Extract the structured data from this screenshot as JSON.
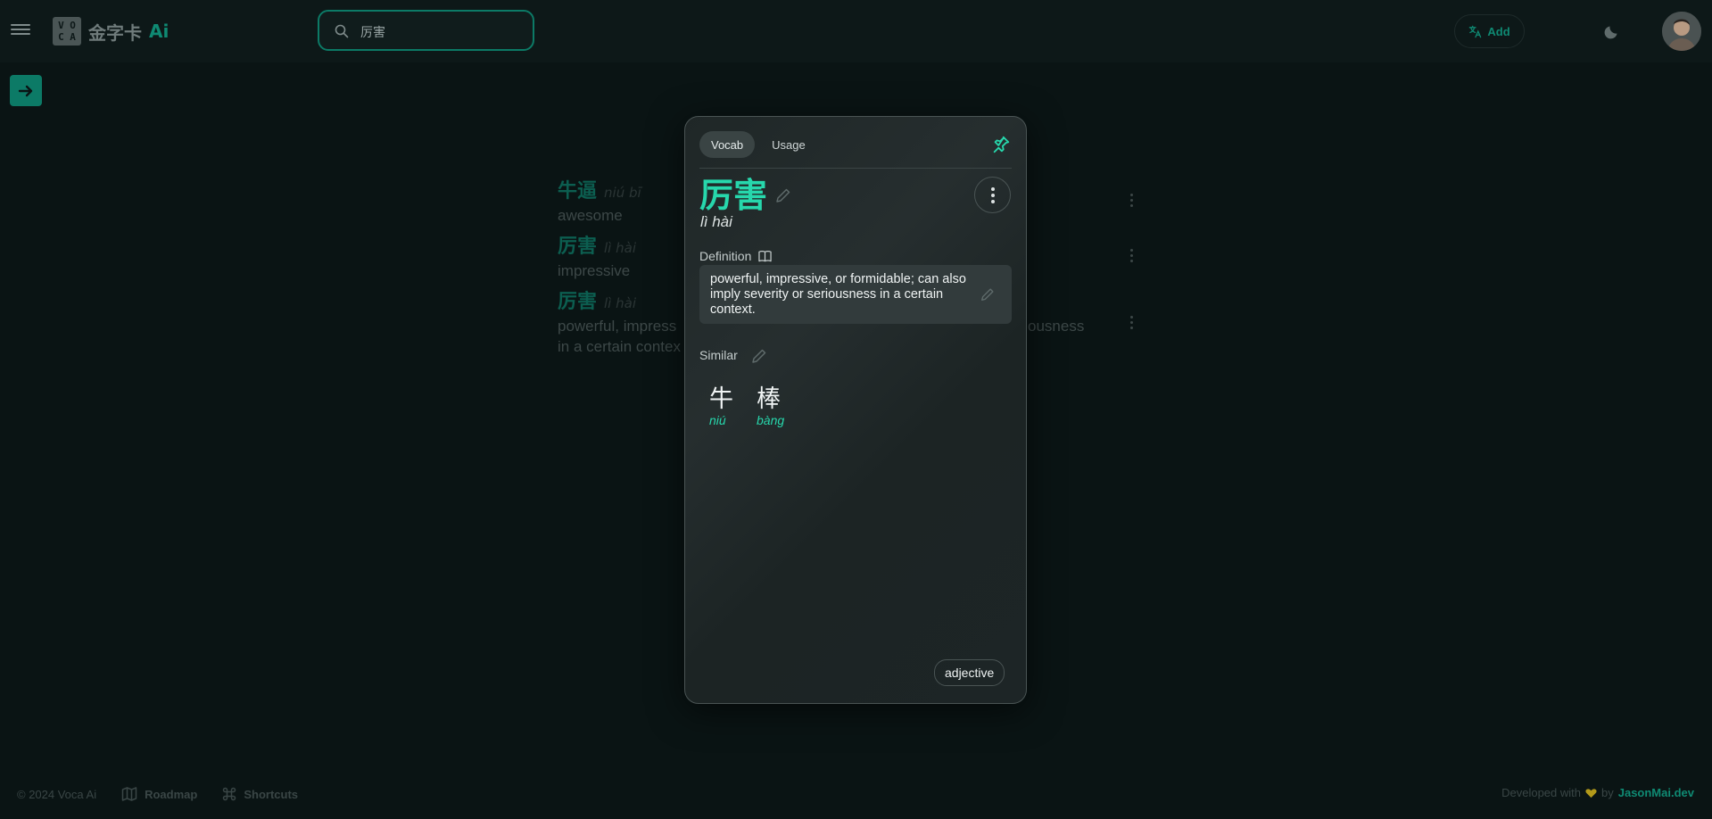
{
  "header": {
    "logo_letters": [
      "V O",
      "C A"
    ],
    "logo_name": "金字卡",
    "logo_ai": "Ai",
    "search_value": "厉害",
    "add_label": "Add"
  },
  "background_list": [
    {
      "hanzi": "牛逼",
      "pinyin": "niú bī",
      "definition": "awesome"
    },
    {
      "hanzi": "厉害",
      "pinyin": "lì hài",
      "definition": "impressive"
    },
    {
      "hanzi": "厉害",
      "pinyin": "lì hài",
      "definition_start": "powerful, impress",
      "definition_end": "ousness",
      "definition_line2": "in a certain contex"
    }
  ],
  "card": {
    "tabs": [
      {
        "label": "Vocab",
        "active": true
      },
      {
        "label": "Usage",
        "active": false
      }
    ],
    "word": "厉害",
    "pinyin": "lì hài",
    "definition_label": "Definition",
    "definition": "powerful, impressive, or formidable; can also imply severity or seriousness in a certain context.",
    "similar_label": "Similar",
    "similar": [
      {
        "hanzi": "牛",
        "pinyin": "niú"
      },
      {
        "hanzi": "棒",
        "pinyin": "bàng"
      }
    ],
    "part_of_speech": "adjective"
  },
  "footer": {
    "copyright": "© 2024 Voca Ai",
    "roadmap": "Roadmap",
    "shortcuts": "Shortcuts",
    "developed_with": "Developed with",
    "by": "by",
    "author": "JasonMai.dev"
  },
  "colors": {
    "accent": "#27d7ac",
    "accent_dark": "#0c7a66",
    "background": "#0a1414",
    "card": "#232b2c"
  },
  "icons": [
    "menu-icon",
    "search-icon",
    "translate-icon",
    "moon-icon",
    "arrow-right-icon",
    "pin-icon",
    "pencil-icon",
    "book-icon",
    "more-vertical-icon",
    "map-icon",
    "command-icon",
    "heart-icon"
  ]
}
